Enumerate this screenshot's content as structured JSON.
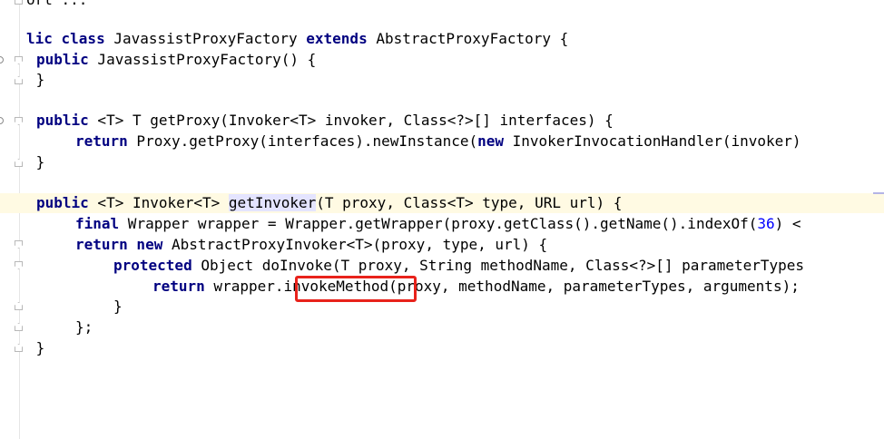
{
  "lines": [
    {
      "text": "ort ..."
    },
    {
      "text": ""
    },
    {
      "kw1": "lic class",
      "t1": " JavassistProxyFactory ",
      "kw2": "extends",
      "t2": " AbstractProxyFactory {"
    },
    {
      "kw1": "public",
      "t1": " JavassistProxyFactory() {"
    },
    {
      "text": " }"
    },
    {
      "text": ""
    },
    {
      "kw1": "public",
      "t1": " <T> T getProxy(Invoker<T> invoker, Class<?>[] interfaces) {"
    },
    {
      "kw1": "return",
      "t1": " Proxy.getProxy(interfaces).newInstance(",
      "kw2": "new",
      "t2": " InvokerInvocationHandler(invoker)"
    },
    {
      "text": " }"
    },
    {
      "text": ""
    },
    {
      "kw1": "public",
      "t1": " <T> Invoker<T> ",
      "hl": "getInvoker",
      "t2": "(T proxy, Class<T> type, URL url) {"
    },
    {
      "kw1": "final",
      "t1": " Wrapper wrapper = Wrapper.getWrapper(proxy.getClass().getName().indexOf(",
      "num": "36",
      "t2": ") <"
    },
    {
      "kw1": "return new",
      "t1": " AbstractProxyInvoker<T>(proxy, type, url) {"
    },
    {
      "kw1": "protected",
      "t1": " Object doInvoke(T proxy, String methodName, Class<?>[] parameterTypes"
    },
    {
      "kw1": "return",
      "t1": " wrapper.",
      "method": "invokeMethod",
      "t2": "(proxy, methodName, parameterTypes, arguments);"
    },
    {
      "text": "}"
    },
    {
      "text": "};"
    },
    {
      "text": " }"
    }
  ]
}
